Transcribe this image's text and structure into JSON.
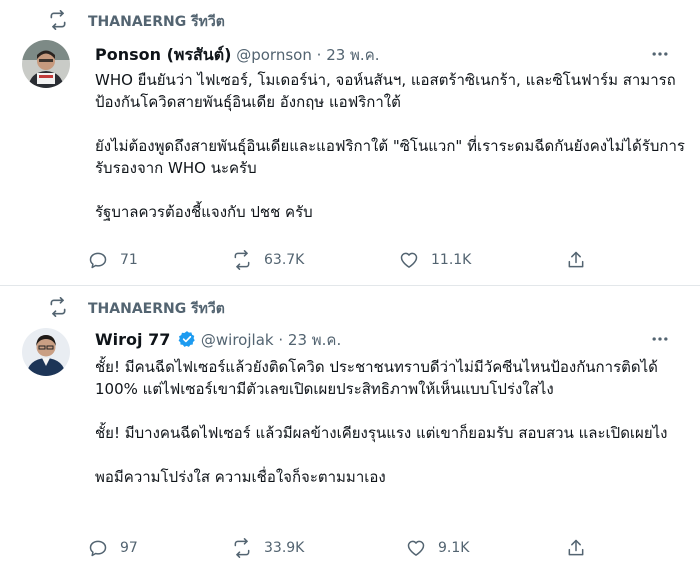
{
  "retweeted_by": "THANAERNG รีทวีต",
  "tweets": [
    {
      "name": "Ponson (พรสันต์)",
      "handle": "@pornson",
      "separator": "·",
      "date": "23 พ.ค.",
      "verified": false,
      "paragraphs": [
        "WHO ยืนยันว่า ไฟเซอร์, โมเดอร์น่า, จอห์นสันฯ, แอสตร้าซิเนกร้า, และซิโนฟาร์ม สามารถป้องกันโควิดสายพันธุ์อินเดีย อังกฤษ แอฟริกาใต้",
        "ยังไม่ต้องพูดถึงสายพันธุ์อินเดียและแอฟริกาใต้ \"ซิโนแวก\" ที่เราระดมฉีดกันยังคงไม่ได้รับการรับรองจาก WHO นะครับ",
        "รัฐบาลควรต้องชี้แจงกับ ปชช ครับ"
      ],
      "replies": "71",
      "retweets": "63.7K",
      "likes": "11.1K"
    },
    {
      "name": "Wiroj 77",
      "handle": "@wirojlak",
      "separator": "·",
      "date": "23 พ.ค.",
      "verified": true,
      "paragraphs": [
        "ชั้ย! มีคนฉีดไฟเซอร์แล้วยังติดโควิด ประชาชนทราบดีว่าไม่มีวัคซีนไหนป้องกันการติดได้ 100% แต่ไฟเซอร์เขามีตัวเลขเปิดเผยประสิทธิภาพให้เห็นแบบโปร่งใสไง",
        "ชั้ย! มีบางคนฉีดไฟเซอร์ แล้วมีผลข้างเคียงรุนแรง แต่เขาก็ยอมรับ สอบสวน และเปิดเผยไง",
        "พอมีความโปร่งใส ความเชื่อใจก็จะตามมาเอง"
      ],
      "replies": "97",
      "retweets": "33.9K",
      "likes": "9.1K"
    }
  ],
  "colors": {
    "text": "#0f1419",
    "secondary": "#536471",
    "verified": "#1d9bf0",
    "divider": "#e3e7ea"
  }
}
